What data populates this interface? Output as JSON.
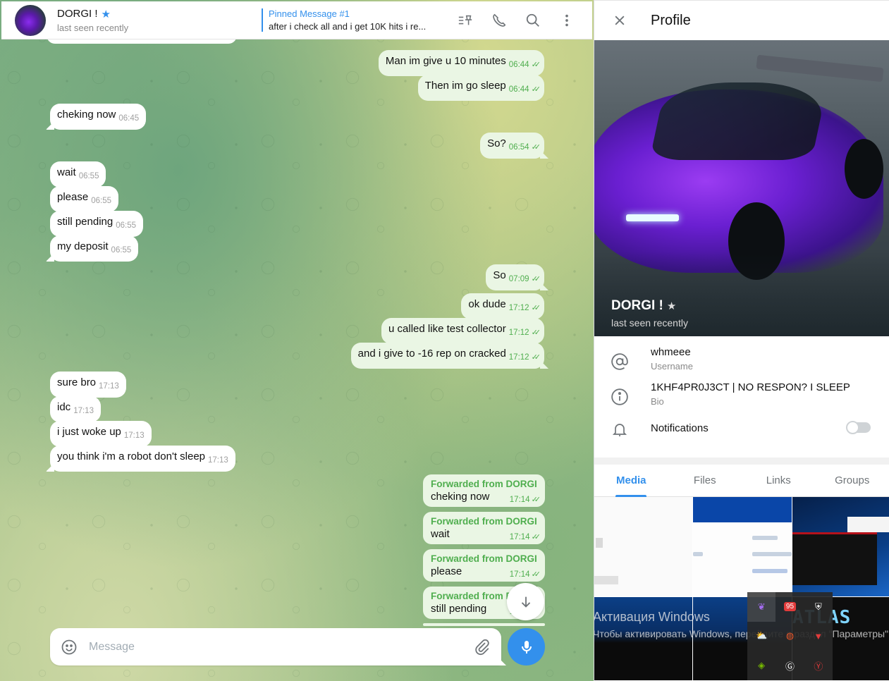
{
  "chat": {
    "header": {
      "name": "DORGI !",
      "status": "last seen recently",
      "pinned_title": "Pinned Message #1",
      "pinned_text": "after i check all and i get 10K hits i re..."
    },
    "icons": {
      "pinned_list": "pinned-list-icon",
      "call": "phone-icon",
      "search": "search-icon",
      "more": "more-vertical-icon"
    },
    "messages": [
      {
        "dir": "out",
        "text": "Man im give u 10 minutes",
        "time": "06:44",
        "read": true
      },
      {
        "dir": "out",
        "text": "Then im go sleep",
        "time": "06:44",
        "read": true
      },
      {
        "dir": "in",
        "text": "cheking now",
        "time": "06:45"
      },
      {
        "dir": "out",
        "text": "So?",
        "time": "06:54",
        "read": true
      },
      {
        "dir": "in",
        "text": "wait",
        "time": "06:55"
      },
      {
        "dir": "in",
        "text": "please",
        "time": "06:55"
      },
      {
        "dir": "in",
        "text": "still pending",
        "time": "06:55"
      },
      {
        "dir": "in",
        "text": "my deposit",
        "time": "06:55"
      },
      {
        "dir": "out",
        "text": "So",
        "time": "07:09",
        "read": true
      },
      {
        "dir": "out",
        "text": "ok dude",
        "time": "17:12",
        "read": true
      },
      {
        "dir": "out",
        "text": "u called like test collector",
        "time": "17:12",
        "read": true
      },
      {
        "dir": "out",
        "text": "and i give to -16 rep on cracked",
        "time": "17:12",
        "read": true
      },
      {
        "dir": "in",
        "text": "sure bro",
        "time": "17:13"
      },
      {
        "dir": "in",
        "text": "idc",
        "time": "17:13"
      },
      {
        "dir": "in",
        "text": "i just woke up",
        "time": "17:13"
      },
      {
        "dir": "in",
        "text": "you think i'm a robot don't sleep",
        "time": "17:13"
      }
    ],
    "forwarded": [
      {
        "from": "Forwarded from DORGI !",
        "text": "cheking now",
        "time": "17:14",
        "read": true
      },
      {
        "from": "Forwarded from DORGI !",
        "text": "wait",
        "time": "17:14",
        "read": true
      },
      {
        "from": "Forwarded from DORGI !",
        "text": "please",
        "time": "17:14",
        "read": true
      },
      {
        "from": "Forwarded from DORGI !",
        "text": "still pending",
        "time": "17:14",
        "read": true
      }
    ],
    "checkmark": "✓✓",
    "composer": {
      "placeholder": "Message",
      "value": ""
    }
  },
  "profile": {
    "title": "Profile",
    "name": "DORGI !",
    "status": "last seen recently",
    "username": "whmeee",
    "username_label": "Username",
    "bio": "1KHF4PR0J3CT | NO RESPON? I SLEEP",
    "bio_label": "Bio",
    "notifications_label": "Notifications",
    "notifications_enabled": false,
    "tabs": [
      "Media",
      "Files",
      "Links",
      "Groups"
    ],
    "active_tab": "Media",
    "media_overlay": {
      "watermark_title": "Активация Windows",
      "watermark_sub": "Чтобы активировать Windows, перейдите в раздел \"Параметры\"",
      "tile_text": "ATLAS",
      "tray_badge": "95"
    }
  },
  "colors": {
    "accent": "#3390ec",
    "outgoing_bubble": "#eaf6e4",
    "outgoing_meta": "#4fae4e"
  }
}
